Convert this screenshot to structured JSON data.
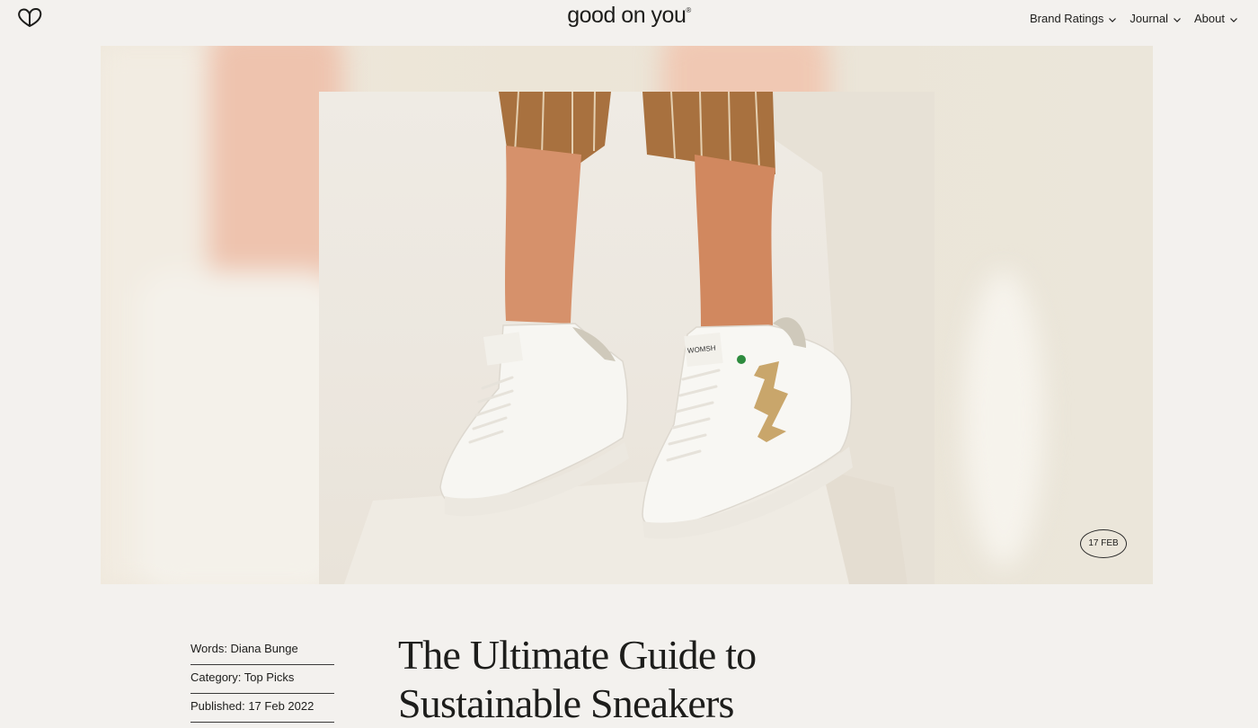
{
  "header": {
    "brand_name": "good on you",
    "brand_mark": "®",
    "logo_icon": "heart-outline-icon",
    "nav": [
      {
        "label": "Brand Ratings",
        "icon": "chevron-down-icon"
      },
      {
        "label": "Journal",
        "icon": "chevron-down-icon"
      },
      {
        "label": "About",
        "icon": "chevron-down-icon"
      }
    ]
  },
  "hero": {
    "shoe_brand_text": "WOMSH",
    "date_badge": "17 FEB"
  },
  "article": {
    "meta": {
      "words": "Words: Diana Bunge",
      "category": "Category: Top Picks",
      "published": "Published: 17 Feb 2022"
    },
    "title_line1": "The Ultimate Guide to",
    "title_line2": "Sustainable Sneakers"
  },
  "colors": {
    "background": "#f3f1ee",
    "text": "#1d1d1b",
    "trouser": "#a8713f",
    "skin": "#d6916b",
    "sneaker": "#f7f6f2",
    "gold_accent": "#c9a66b"
  }
}
